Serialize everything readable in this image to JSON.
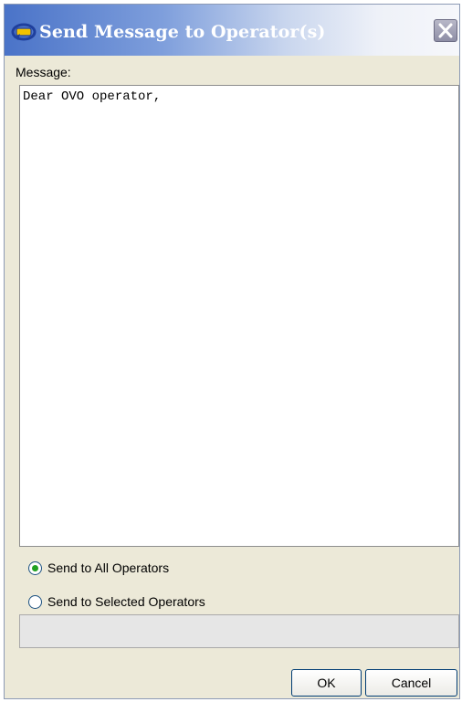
{
  "window": {
    "title": "Send Message to Operator(s)",
    "close_icon": "close-icon",
    "app_icon": "operator-message-icon"
  },
  "message": {
    "label": "Message:",
    "value": "Dear OVO operator,"
  },
  "recipients": {
    "options": [
      {
        "label": "Send to All Operators",
        "selected": true
      },
      {
        "label": "Send to Selected Operators",
        "selected": false
      }
    ],
    "selected_operators_value": ""
  },
  "buttons": {
    "ok_label": "OK",
    "cancel_label": "Cancel"
  },
  "colors": {
    "titlebar_start": "#4a73c8",
    "dialog_background": "#ece9d8",
    "radio_selected": "#21a121"
  }
}
